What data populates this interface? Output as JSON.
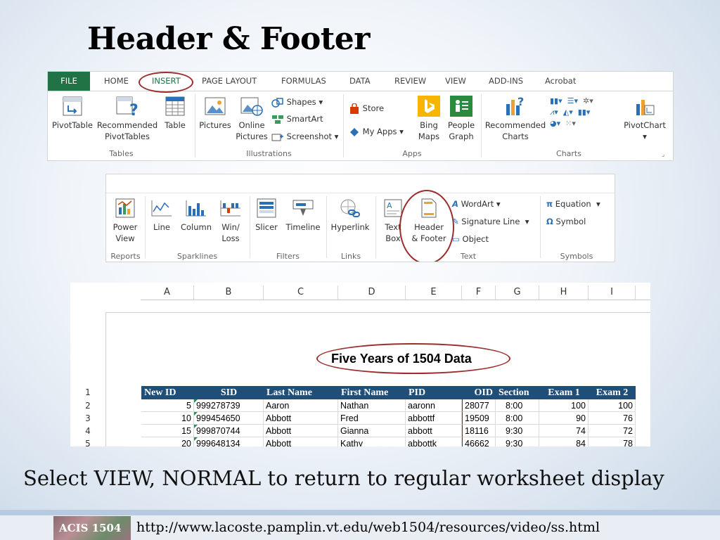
{
  "slide": {
    "title": "Header & Footer",
    "caption": "Select VIEW, NORMAL to return to regular worksheet display",
    "footer_logo": "ACIS 1504",
    "footer_url": "http://www.lacoste.pamplin.vt.edu/web1504/resources/video/ss.html"
  },
  "ribbon_tabs": [
    "FILE",
    "HOME",
    "INSERT",
    "PAGE LAYOUT",
    "FORMULAS",
    "DATA",
    "REVIEW",
    "VIEW",
    "ADD-INS",
    "Acrobat"
  ],
  "ribbon1": {
    "pivottable": "PivotTable",
    "recommended_pivot": [
      "Recommended",
      "PivotTables"
    ],
    "table": "Table",
    "pictures": "Pictures",
    "online_pictures": [
      "Online",
      "Pictures"
    ],
    "shapes": "Shapes",
    "smartart": "SmartArt",
    "screenshot": "Screenshot",
    "store": "Store",
    "my_apps": "My Apps",
    "bing_maps": [
      "Bing",
      "Maps"
    ],
    "people_graph": [
      "People",
      "Graph"
    ],
    "recommended_charts": [
      "Recommended",
      "Charts"
    ],
    "pivotchart": "PivotChart",
    "groups": [
      "Tables",
      "Illustrations",
      "Apps",
      "Charts"
    ]
  },
  "ribbon2": {
    "power_view": [
      "Power",
      "View"
    ],
    "line": "Line",
    "column": "Column",
    "winloss": [
      "Win/",
      "Loss"
    ],
    "slicer": "Slicer",
    "timeline": "Timeline",
    "hyperlink": "Hyperlink",
    "text_box": [
      "Text",
      "Box"
    ],
    "header_footer": [
      "Header",
      "& Footer"
    ],
    "wordart": "WordArt",
    "signature_line": "Signature Line",
    "object": "Object",
    "equation": "Equation",
    "symbol": "Symbol",
    "groups": [
      "Reports",
      "Sparklines",
      "Filters",
      "Links",
      "Text",
      "Symbols"
    ]
  },
  "sheet": {
    "columns": [
      "A",
      "B",
      "C",
      "D",
      "E",
      "F",
      "G",
      "H",
      "I"
    ],
    "title": "Five Years of 1504 Data",
    "row_numbers": [
      "1",
      "2",
      "3",
      "4",
      "5"
    ],
    "headers": [
      "New ID",
      "SID",
      "Last Name",
      "First Name",
      "PID",
      "OID",
      "Section",
      "Exam 1",
      "Exam 2"
    ],
    "rows": [
      [
        "5",
        "999278739",
        "Aaron",
        "Nathan",
        "aaronn",
        "28077",
        "8:00",
        "100",
        "100"
      ],
      [
        "10",
        "999454650",
        "Abbott",
        "Fred",
        "abbottf",
        "19509",
        "8:00",
        "90",
        "76"
      ],
      [
        "15",
        "999870744",
        "Abbott",
        "Gianna",
        "abbott",
        "18116",
        "9:30",
        "74",
        "72"
      ],
      [
        "20",
        "999648134",
        "Abbott",
        "Kathy",
        "abbottk",
        "46662",
        "9:30",
        "84",
        "78"
      ]
    ]
  },
  "colors": {
    "excel_green": "#217346",
    "highlight_ring": "#9b2d2d",
    "table_header": "#1f4e79"
  }
}
